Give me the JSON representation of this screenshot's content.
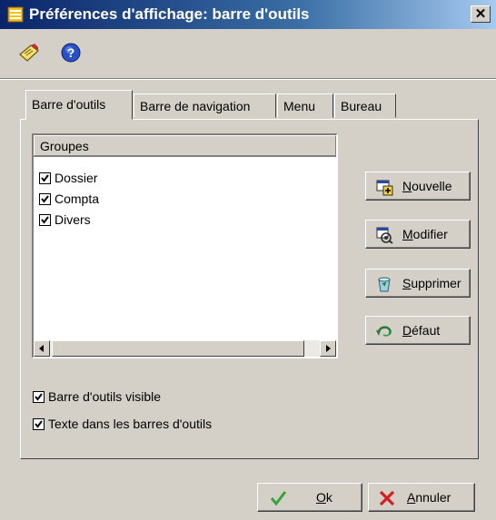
{
  "window": {
    "title": "Préférences d'affichage: barre d'outils",
    "close_glyph": "✕"
  },
  "toolbar": {
    "icons": [
      "edit-note-icon",
      "help-icon"
    ]
  },
  "tabs": [
    {
      "label": "Barre d'outils",
      "active": true
    },
    {
      "label": "Barre de navigation",
      "active": false
    },
    {
      "label": "Menu",
      "active": false
    },
    {
      "label": "Bureau",
      "active": false
    }
  ],
  "groups_list": {
    "header": "Groupes",
    "items": [
      {
        "label": "Dossier",
        "checked": true
      },
      {
        "label": "Compta",
        "checked": true
      },
      {
        "label": "Divers",
        "checked": true
      }
    ]
  },
  "side_buttons": {
    "new": {
      "mnemonic": "N",
      "rest": "ouvelle"
    },
    "edit": {
      "mnemonic": "M",
      "rest": "odifier"
    },
    "delete": {
      "mnemonic": "S",
      "rest": "upprimer"
    },
    "default": {
      "mnemonic": "D",
      "rest": "éfaut"
    }
  },
  "options": [
    {
      "label": "Barre d'outils visible",
      "checked": true
    },
    {
      "label": "Texte dans les barres d'outils",
      "checked": true
    }
  ],
  "footer": {
    "ok": {
      "mnemonic": "O",
      "rest": "k"
    },
    "cancel": {
      "mnemonic": "A",
      "rest": "nnuler"
    }
  },
  "colors": {
    "title_start": "#0a246a",
    "title_end": "#a6caf0",
    "face": "#d4d0c8",
    "ok_green": "#3aa23a",
    "cancel_red": "#d42020"
  }
}
